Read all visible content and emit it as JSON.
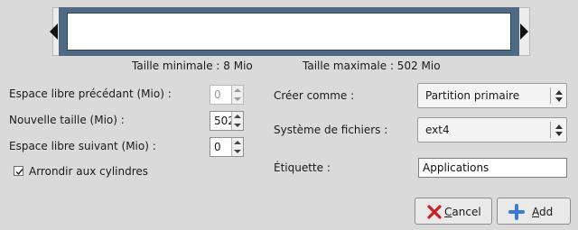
{
  "resizer": {
    "min_size_label": "Taille minimale : 8 Mio",
    "max_size_label": "Taille maximale : 502 Mio"
  },
  "fields": {
    "free_before": {
      "label": "Espace libre précédant (Mio) :",
      "value": "0"
    },
    "new_size": {
      "label": "Nouvelle taille (Mio) :",
      "value": "502"
    },
    "free_after": {
      "label": "Espace libre suivant (Mio) :",
      "value": "0"
    },
    "round_cylinders": {
      "label": "Arrondir aux cylindres",
      "checked": true
    }
  },
  "right": {
    "create_as": {
      "label": "Créer comme :",
      "value": "Partition primaire"
    },
    "filesystem": {
      "label": "Système de fichiers :",
      "value": "ext4"
    },
    "label_field": {
      "label": "Étiquette :",
      "value": "Applications"
    }
  },
  "buttons": {
    "cancel_first": "C",
    "cancel_rest": "ancel",
    "add_first": "A",
    "add_rest": "dd"
  },
  "colors": {
    "partition": "#4e6a86",
    "cancel_icon": "#cc2020",
    "add_icon": "#3a7bd5"
  }
}
